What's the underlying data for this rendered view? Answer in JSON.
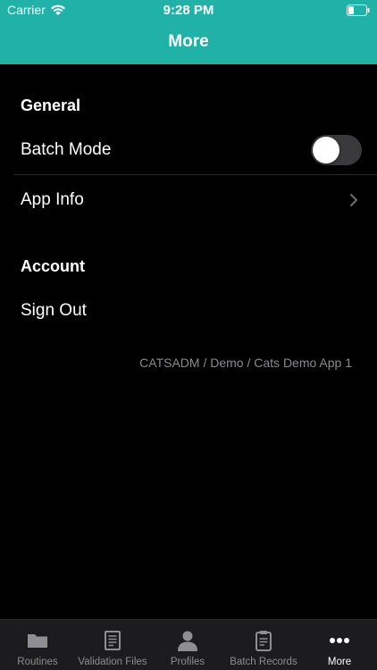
{
  "status_bar": {
    "carrier": "Carrier",
    "time": "9:28 PM"
  },
  "nav": {
    "title": "More"
  },
  "sections": {
    "general": {
      "header": "General",
      "batch_mode": {
        "label": "Batch Mode",
        "enabled": false
      },
      "app_info": {
        "label": "App Info"
      }
    },
    "account": {
      "header": "Account",
      "sign_out": {
        "label": "Sign Out"
      }
    }
  },
  "footer": {
    "context": "CATSADM / Demo / Cats Demo App 1"
  },
  "tabs": [
    {
      "label": "Routines",
      "icon": "folder-icon",
      "active": false
    },
    {
      "label": "Validation Files",
      "icon": "document-icon",
      "active": false
    },
    {
      "label": "Profiles",
      "icon": "person-icon",
      "active": false
    },
    {
      "label": "Batch Records",
      "icon": "clipboard-icon",
      "active": false
    },
    {
      "label": "More",
      "icon": "ellipsis-icon",
      "active": true
    }
  ],
  "colors": {
    "accent": "#20b2a6",
    "background": "#000000",
    "tab_bar": "#1c1c1e",
    "inactive": "#8e8e93",
    "toggle_off": "#3a3a3c"
  }
}
